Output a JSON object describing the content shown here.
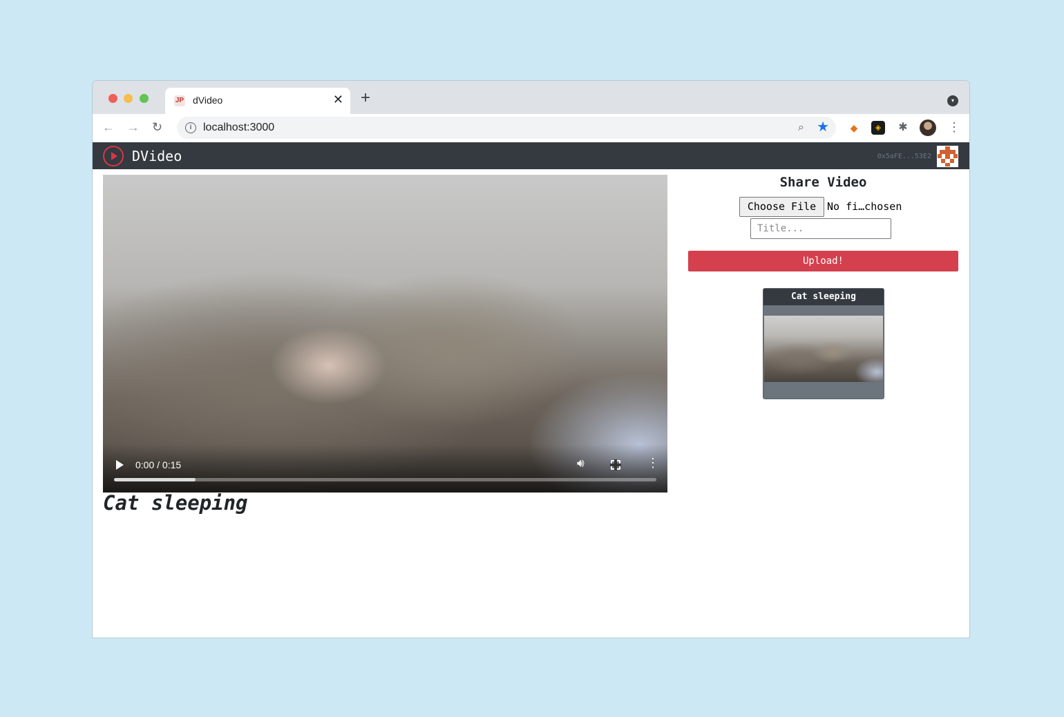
{
  "browser": {
    "tab_title": "dVideo",
    "tab_favicon": "JP",
    "tab_close": "✕",
    "new_tab": "+",
    "url": "localhost:3000",
    "icons": [
      "back-arrow-icon",
      "forward-arrow-icon",
      "reload-icon",
      "site-info-icon",
      "zoom-icon",
      "bookmark-star-icon",
      "metamask-fox-icon",
      "extension-box-icon",
      "extensions-puzzle-icon",
      "profile-avatar-icon",
      "browser-menu-icon"
    ]
  },
  "navbar": {
    "brand": "DVideo",
    "account": "0x5aFE...53E2",
    "colors": {
      "background": "#343a40",
      "accent": "#dc3545"
    }
  },
  "player": {
    "time": "0:00 / 0:15",
    "progress_fraction": 0.15
  },
  "current_video": {
    "title": "Cat sleeping"
  },
  "share": {
    "heading": "Share Video",
    "choose_file_label": "Choose File",
    "no_file_text": "No fi…chosen",
    "title_placeholder": "Title...",
    "upload_label": "Upload!",
    "upload_color": "#d4404d"
  },
  "video_list": [
    {
      "title": "Cat sleeping"
    }
  ]
}
